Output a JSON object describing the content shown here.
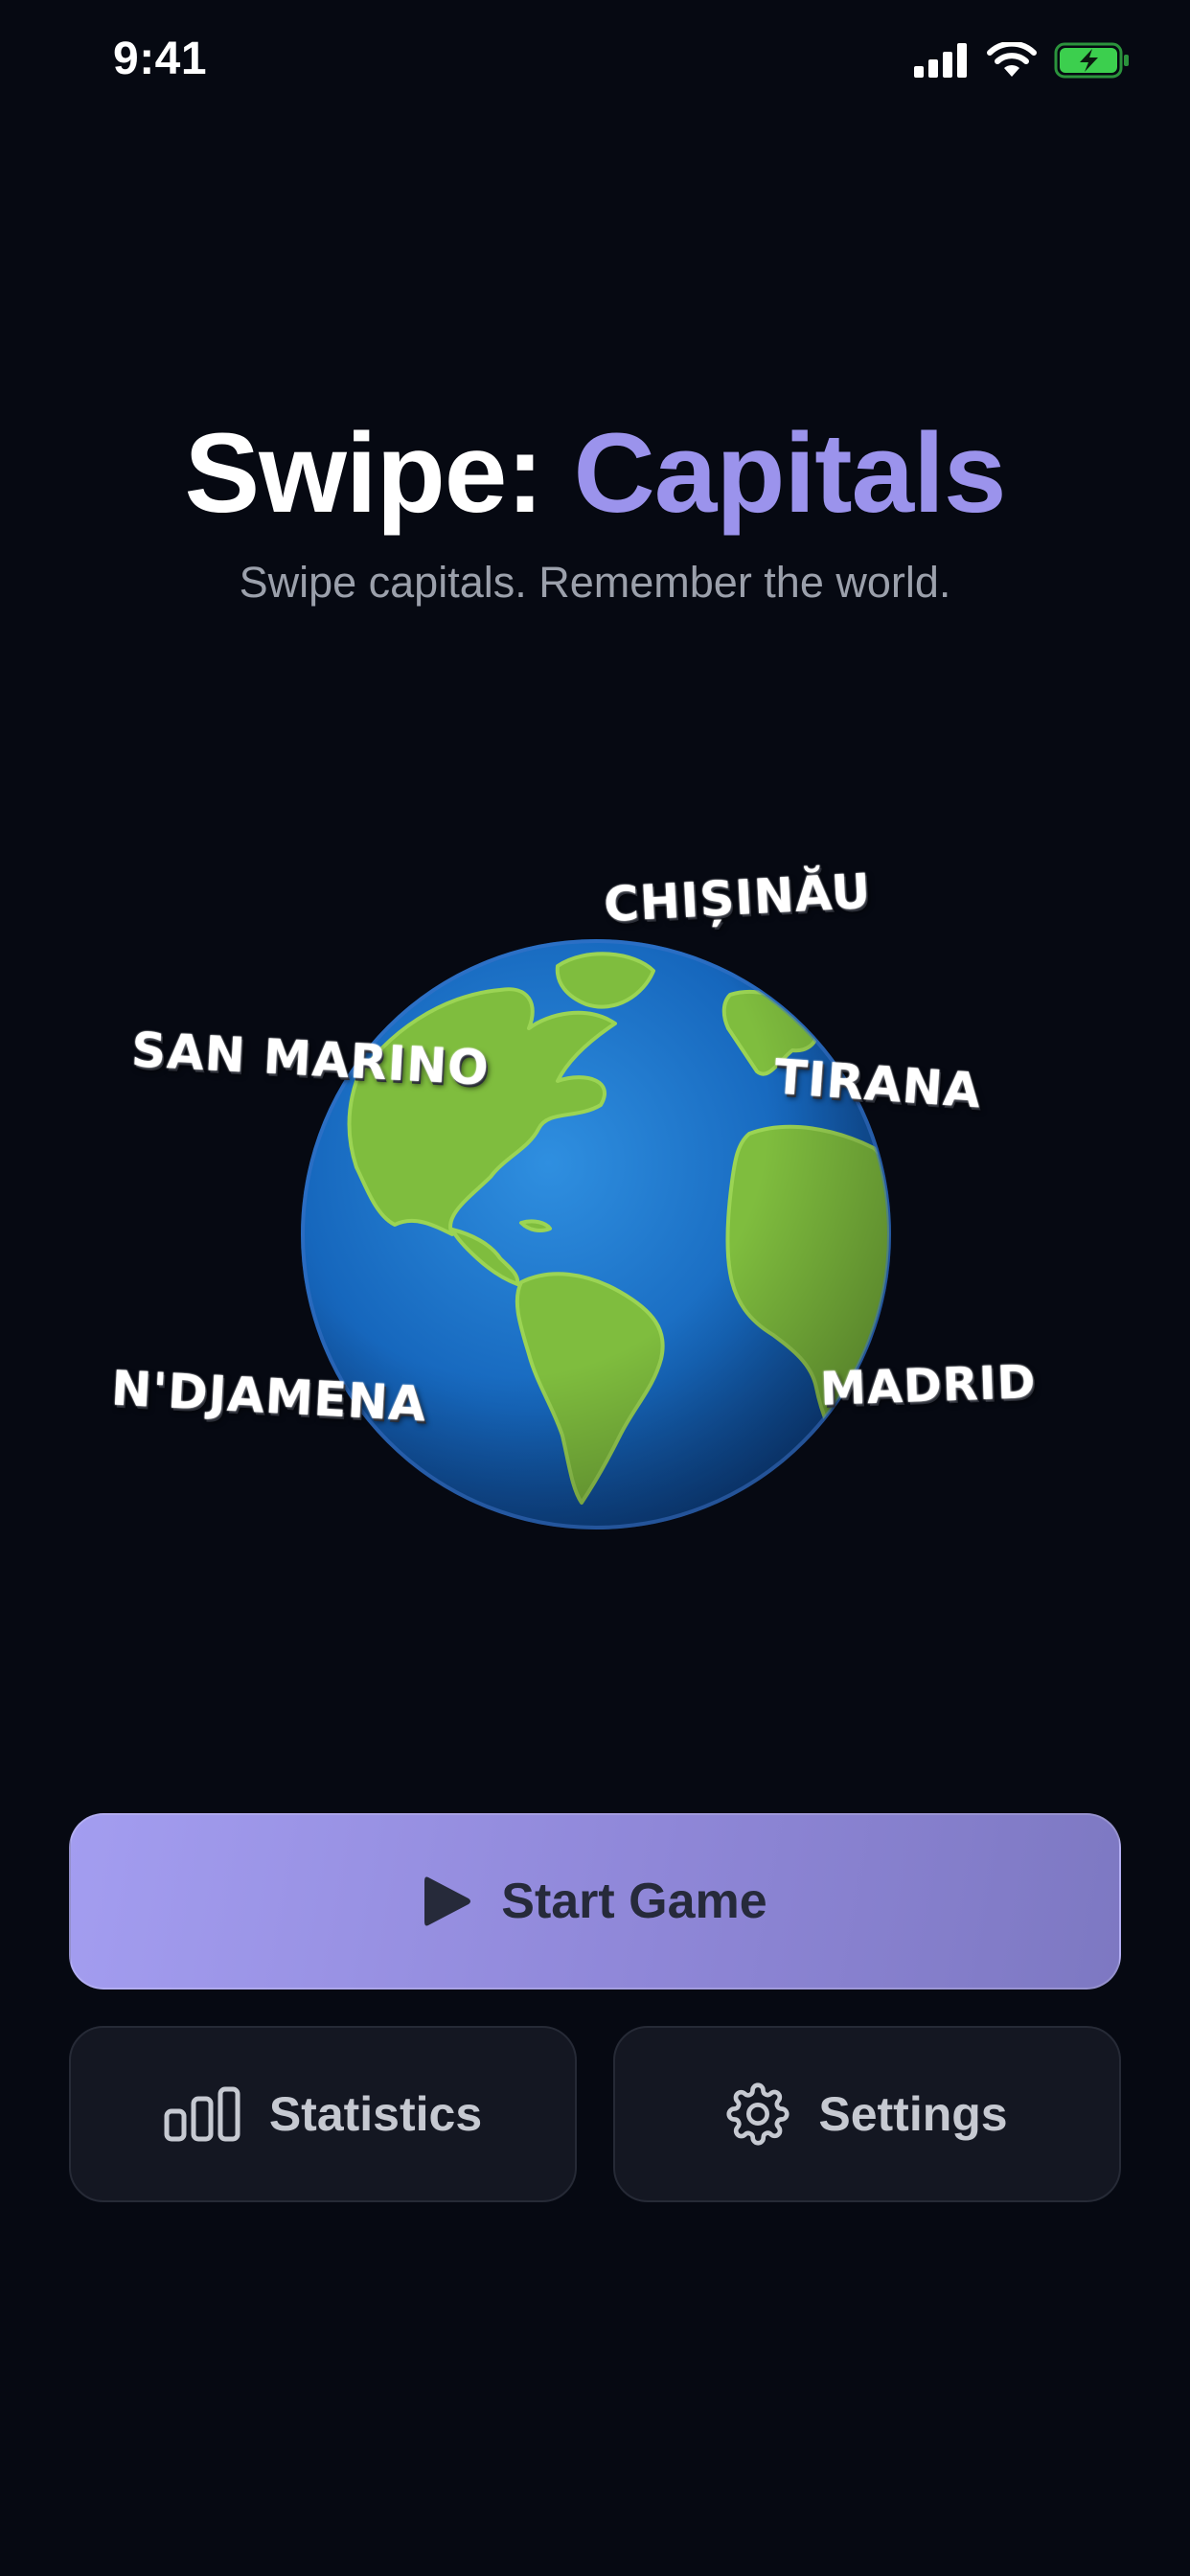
{
  "status_bar": {
    "time": "9:41",
    "icons": [
      "signal-icon",
      "wifi-icon",
      "battery-charging-icon"
    ],
    "battery_color": "#3ccf4e"
  },
  "header": {
    "title_main": "Swipe:",
    "title_accent": "Capitals",
    "subtitle": "Swipe capitals. Remember the world."
  },
  "hero": {
    "image": "earth-globe",
    "capitals": [
      "CHIȘINĂU",
      "SAN MARINO",
      "TIRANA",
      "N'DJAMENA",
      "MADRID"
    ]
  },
  "actions": {
    "start": {
      "label": "Start Game",
      "icon": "play-icon"
    },
    "statistics": {
      "label": "Statistics",
      "icon": "bar-chart-icon"
    },
    "settings": {
      "label": "Settings",
      "icon": "gear-icon"
    }
  },
  "colors": {
    "background": "#060912",
    "accent": "#9b93ec",
    "start_gradient_from": "#a39df0",
    "start_gradient_to": "#7d78c2",
    "secondary_button": "#141722"
  }
}
